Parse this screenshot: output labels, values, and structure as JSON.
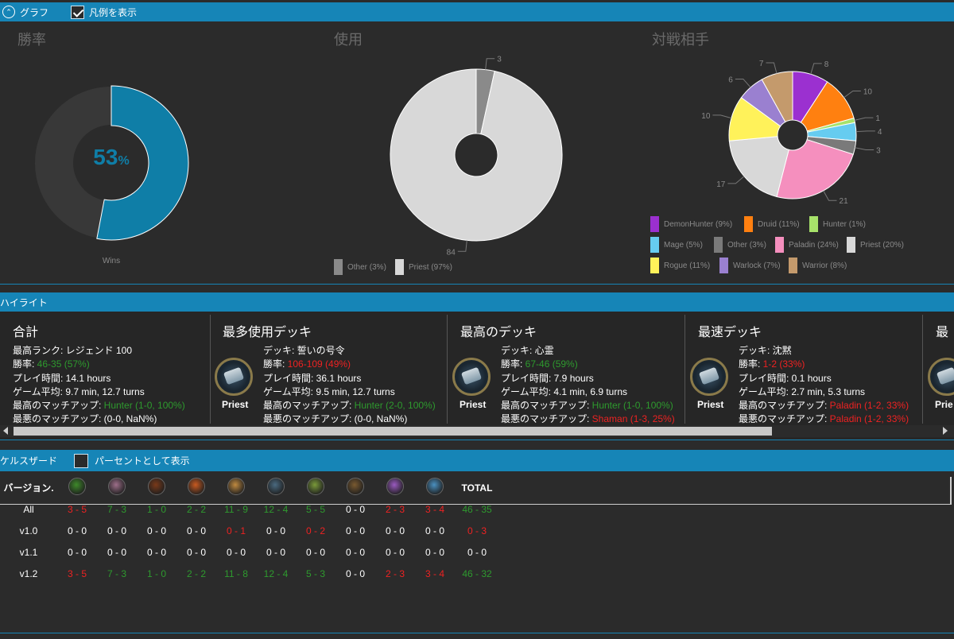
{
  "graph_section": {
    "title": "グラフ",
    "show_legend_label": "凡例を表示",
    "show_legend_checked": true
  },
  "winrate": {
    "title": "勝率",
    "value": 53,
    "value_text": "53",
    "percent_sign": "%",
    "label": "Wins"
  },
  "usage": {
    "title": "使用",
    "chart_data": {
      "type": "pie",
      "categories": [
        "Other",
        "Priest"
      ],
      "values": [
        3,
        84
      ],
      "labels": [
        "3",
        "84"
      ],
      "legend": [
        "Other (3%)",
        "Priest (97%)"
      ],
      "colors": [
        "#8a8a8a",
        "#d8d8d8"
      ]
    }
  },
  "opponents": {
    "title": "対戦相手",
    "chart_data": {
      "type": "pie",
      "categories": [
        "DemonHunter",
        "Druid",
        "Hunter",
        "Mage",
        "Other",
        "Paladin",
        "Priest",
        "Rogue",
        "Warlock",
        "Warrior"
      ],
      "values": [
        8,
        10,
        1,
        4,
        3,
        21,
        17,
        10,
        6,
        7
      ],
      "colors": [
        "#9b30d0",
        "#ff8010",
        "#a7e26a",
        "#66ccf0",
        "#7a7a7a",
        "#f58fbe",
        "#d8d8d8",
        "#fff25a",
        "#9a80d0",
        "#c49a6c"
      ],
      "legend": [
        "DemonHunter (9%)",
        "Druid (11%)",
        "Hunter (1%)",
        "Mage (5%)",
        "Other (3%)",
        "Paladin (24%)",
        "Priest (20%)",
        "Rogue (11%)",
        "Warlock (7%)",
        "Warrior (8%)"
      ]
    }
  },
  "highlights": {
    "title": "ハイライト",
    "total": {
      "title": "合計",
      "rank_label": "最高ランク: ",
      "rank_value": "レジェンド 100",
      "winrate_label": "勝率: ",
      "winrate_value": "46-35 (57%)",
      "playtime_label": "プレイ時間: ",
      "playtime_value": "14.1 hours",
      "avg_label": "ゲーム平均: ",
      "avg_value": "9.7 min, 12.7 turns",
      "best_label": "最高のマッチアップ: ",
      "best_value": "Hunter (1-0, 100%)",
      "worst_label": "最悪のマッチアップ: ",
      "worst_value": " (0-0, NaN%)"
    },
    "most_used": {
      "title": "最多使用デッキ",
      "class": "Priest",
      "deck_label": "デッキ: ",
      "deck_value": "誓いの号令",
      "winrate_label": "勝率: ",
      "winrate_value": "106-109 (49%)",
      "playtime_label": "プレイ時間: ",
      "playtime_value": "36.1 hours",
      "avg_label": "ゲーム平均: ",
      "avg_value": "9.5 min, 12.7 turns",
      "best_label": "最高のマッチアップ: ",
      "best_value": "Hunter (2-0, 100%)",
      "worst_label": "最悪のマッチアップ: ",
      "worst_value": " (0-0, NaN%)"
    },
    "best": {
      "title": "最高のデッキ",
      "class": "Priest",
      "deck_label": "デッキ: ",
      "deck_value": "心霊",
      "winrate_label": "勝率: ",
      "winrate_value": "67-46 (59%)",
      "playtime_label": "プレイ時間: ",
      "playtime_value": "7.9 hours",
      "avg_label": "ゲーム平均: ",
      "avg_value": "4.1 min, 6.9 turns",
      "best_label": "最高のマッチアップ: ",
      "best_value": "Hunter (1-0, 100%)",
      "worst_label": "最悪のマッチアップ: ",
      "worst_value": "Shaman (1-3, 25%)"
    },
    "fastest": {
      "title": "最速デッキ",
      "class": "Priest",
      "deck_label": "デッキ: ",
      "deck_value": "沈黙",
      "winrate_label": "勝率: ",
      "winrate_value": "1-2 (33%)",
      "playtime_label": "プレイ時間: ",
      "playtime_value": "0.1 hours",
      "avg_label": "ゲーム平均: ",
      "avg_value": "2.7 min, 5.3 turns",
      "best_label": "最高のマッチアップ: ",
      "best_value": "Paladin (1-2, 33%)",
      "worst_label": "最悪のマッチアップ: ",
      "worst_value": "Paladin (1-2, 33%)"
    },
    "partial": {
      "title": "最",
      "class": "Prie"
    }
  },
  "matchups": {
    "title": "ケルスザード",
    "percent_label": "パーセントとして表示",
    "percent_checked": false,
    "version_header": "バージョン.",
    "total_header": "TOTAL",
    "class_icons": [
      "druid-icon",
      "hunter-icon",
      "mage-icon",
      "paladin-icon",
      "priest-icon",
      "rogue-icon",
      "shaman-icon",
      "warlock-icon",
      "warrior-icon",
      "demonhunter-icon"
    ],
    "rows": [
      {
        "version": "All",
        "cells": [
          {
            "v": "3 - 5",
            "c": "red"
          },
          {
            "v": "7 - 3",
            "c": "grn"
          },
          {
            "v": "1 - 0",
            "c": "grn"
          },
          {
            "v": "2 - 2",
            "c": "grn"
          },
          {
            "v": "11 - 9",
            "c": "grn"
          },
          {
            "v": "12 - 4",
            "c": "grn"
          },
          {
            "v": "5 - 5",
            "c": "grn"
          },
          {
            "v": "0 - 0",
            "c": "wht"
          },
          {
            "v": "2 - 3",
            "c": "red"
          },
          {
            "v": "3 - 4",
            "c": "red"
          }
        ],
        "total": {
          "v": "46 - 35",
          "c": "grn"
        }
      },
      {
        "version": "v1.0",
        "cells": [
          {
            "v": "0 - 0",
            "c": "wht"
          },
          {
            "v": "0 - 0",
            "c": "wht"
          },
          {
            "v": "0 - 0",
            "c": "wht"
          },
          {
            "v": "0 - 0",
            "c": "wht"
          },
          {
            "v": "0 - 1",
            "c": "red"
          },
          {
            "v": "0 - 0",
            "c": "wht"
          },
          {
            "v": "0 - 2",
            "c": "red"
          },
          {
            "v": "0 - 0",
            "c": "wht"
          },
          {
            "v": "0 - 0",
            "c": "wht"
          },
          {
            "v": "0 - 0",
            "c": "wht"
          }
        ],
        "total": {
          "v": "0 - 3",
          "c": "red"
        }
      },
      {
        "version": "v1.1",
        "cells": [
          {
            "v": "0 - 0",
            "c": "wht"
          },
          {
            "v": "0 - 0",
            "c": "wht"
          },
          {
            "v": "0 - 0",
            "c": "wht"
          },
          {
            "v": "0 - 0",
            "c": "wht"
          },
          {
            "v": "0 - 0",
            "c": "wht"
          },
          {
            "v": "0 - 0",
            "c": "wht"
          },
          {
            "v": "0 - 0",
            "c": "wht"
          },
          {
            "v": "0 - 0",
            "c": "wht"
          },
          {
            "v": "0 - 0",
            "c": "wht"
          },
          {
            "v": "0 - 0",
            "c": "wht"
          }
        ],
        "total": {
          "v": "0 - 0",
          "c": "wht"
        }
      },
      {
        "version": "v1.2",
        "cells": [
          {
            "v": "3 - 5",
            "c": "red"
          },
          {
            "v": "7 - 3",
            "c": "grn"
          },
          {
            "v": "1 - 0",
            "c": "grn"
          },
          {
            "v": "2 - 2",
            "c": "grn"
          },
          {
            "v": "11 - 8",
            "c": "grn"
          },
          {
            "v": "12 - 4",
            "c": "grn"
          },
          {
            "v": "5 - 3",
            "c": "grn"
          },
          {
            "v": "0 - 0",
            "c": "wht"
          },
          {
            "v": "2 - 3",
            "c": "red"
          },
          {
            "v": "3 - 4",
            "c": "red"
          }
        ],
        "total": {
          "v": "46 - 32",
          "c": "grn"
        }
      }
    ]
  },
  "colors": {
    "accent": "#1685b7",
    "win": "#2e9a2e",
    "loss": "#ee2222",
    "winrate_fill": "#0f7ea7"
  }
}
